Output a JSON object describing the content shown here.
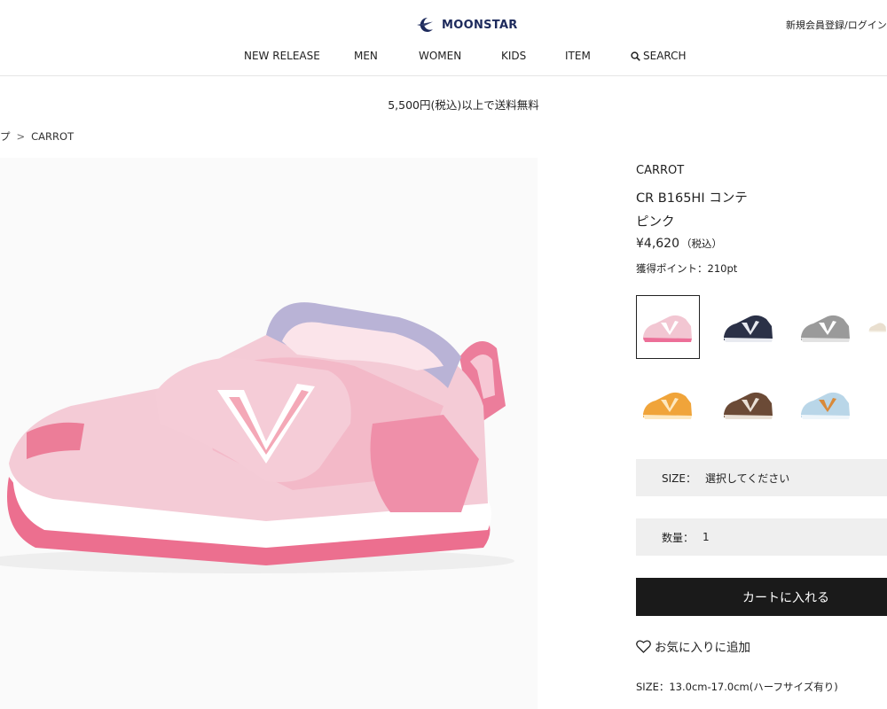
{
  "header": {
    "logo_text": "MOONSTAR",
    "account_link": "新規会員登録/ログイン",
    "nav": [
      {
        "label": "NEW RELEASE"
      },
      {
        "label": "MEN"
      },
      {
        "label": "WOMEN"
      },
      {
        "label": "KIDS"
      },
      {
        "label": "ITEM"
      },
      {
        "label": "SEARCH",
        "icon": "search-icon"
      }
    ]
  },
  "banner": {
    "shipping": "5,500円(税込)以上で送料無料"
  },
  "breadcrumb": {
    "prev": "プ",
    "separator": ">",
    "current": "CARROT"
  },
  "product": {
    "brand": "CARROT",
    "name": "CR B165HI コンテ",
    "color": "ピンク",
    "price": "¥4,620",
    "price_tax": "（税込）",
    "points": "獲得ポイント：210pt",
    "image_icon": "pink-sneaker-image"
  },
  "swatches": [
    {
      "name": "pink",
      "color": "#f2c6d2",
      "accent": "#ec6f98",
      "selected": true
    },
    {
      "name": "navy",
      "color": "#2b3147",
      "accent": "#e8eaf0",
      "selected": false
    },
    {
      "name": "gray",
      "color": "#9a9a9a",
      "accent": "#e2e2e2",
      "selected": false
    },
    {
      "name": "beige",
      "color": "#e9dfcf",
      "accent": "#f7f3ea",
      "selected": false
    },
    {
      "name": "orange",
      "color": "#f0a43a",
      "accent": "#fde8c0",
      "selected": false
    },
    {
      "name": "brown",
      "color": "#6b4a36",
      "accent": "#e9e0d6",
      "selected": false
    },
    {
      "name": "light-blue",
      "color": "#b9d6e8",
      "accent": "#d98a3a",
      "selected": false
    }
  ],
  "size_select": {
    "label": "SIZE：",
    "value": "選択してください"
  },
  "quantity_select": {
    "label": "数量：",
    "value": "1"
  },
  "cart_button": "カートに入れる",
  "favorite": {
    "label": "お気に入りに追加",
    "icon": "heart-icon"
  },
  "size_range": "SIZE：13.0cm-17.0cm(ハーフサイズ有り)",
  "colors": {
    "dark_button": "#1a1a1a",
    "select_bg": "#efefef",
    "logo_navy": "#1d2a5c"
  }
}
